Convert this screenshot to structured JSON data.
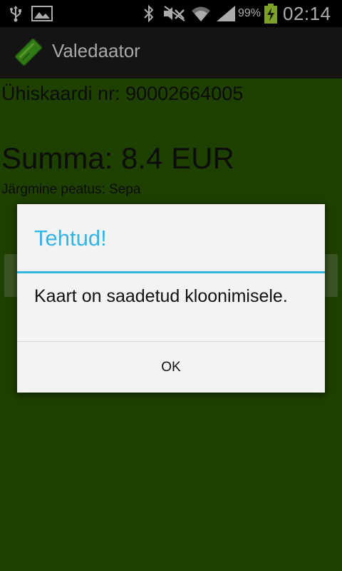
{
  "status_bar": {
    "battery_percent": "99%",
    "time": "02:14",
    "icons": [
      "usb-icon",
      "image-icon",
      "bluetooth-icon",
      "mute-icon",
      "wifi-icon",
      "signal-icon",
      "battery-charging-icon"
    ]
  },
  "action_bar": {
    "title": "Valedaator",
    "icon": "ticket-card-icon"
  },
  "main": {
    "card_number_line": "Ühiskaardi nr: 90002664005",
    "sum_line": "Summa: 8.4 EUR",
    "next_stop_line": "Järgmine peatus: Sepa"
  },
  "dialog": {
    "title": "Tehtud!",
    "message": "Kaart on saadetud kloonimisele.",
    "ok_label": "OK"
  },
  "colors": {
    "background_green": "#275200",
    "dialog_accent": "#33b5e5",
    "dialog_background": "#f3f3f3"
  }
}
